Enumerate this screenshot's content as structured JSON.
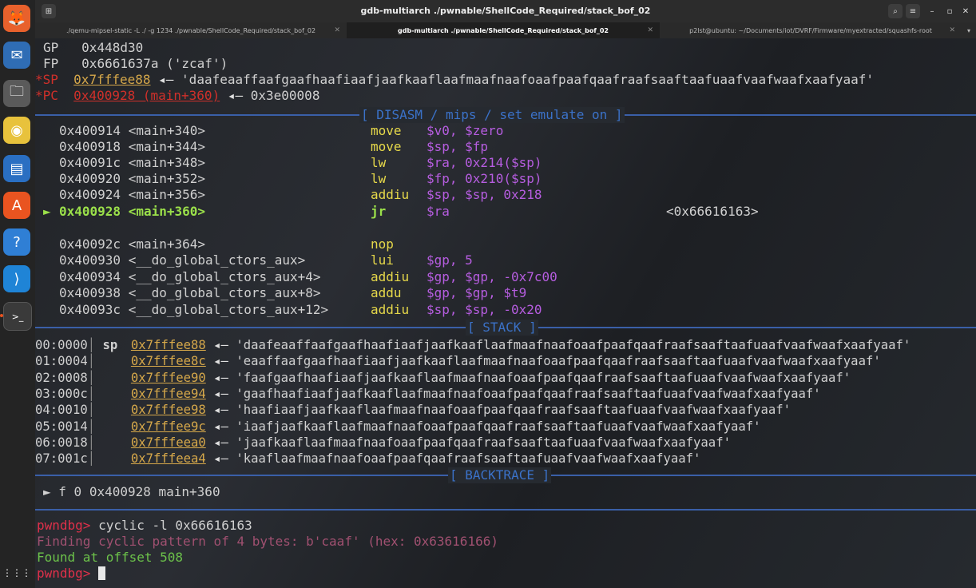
{
  "window": {
    "title": "gdb-multiarch ./pwnable/ShellCode_Required/stack_bof_02"
  },
  "tabs": [
    {
      "label": "./qemu-mipsel-static -L ./ -g 1234 ./pwnable/ShellCode_Required/stack_bof_02",
      "active": false
    },
    {
      "label": "gdb-multiarch ./pwnable/ShellCode_Required/stack_bof_02",
      "active": true
    },
    {
      "label": "p2lst@ubuntu: ~/Documents/iot/DVRF/Firmware/myextracted/squashfs-root",
      "active": false
    }
  ],
  "dock": [
    {
      "name": "firefox-icon",
      "glyph": "🦊"
    },
    {
      "name": "thunderbird-icon",
      "glyph": "✉"
    },
    {
      "name": "files-icon",
      "glyph": "🗀"
    },
    {
      "name": "rhythmbox-icon",
      "glyph": "◉"
    },
    {
      "name": "writer-icon",
      "glyph": "▤"
    },
    {
      "name": "software-icon",
      "glyph": "A"
    },
    {
      "name": "help-icon",
      "glyph": "?"
    },
    {
      "name": "vscode-icon",
      "glyph": "⟩"
    },
    {
      "name": "terminal-icon",
      "glyph": ">_"
    },
    {
      "name": "app-grid-icon",
      "glyph": "⋮⋮⋮"
    }
  ],
  "registers": {
    "gp": {
      "name": "GP",
      "value": "0x448d30"
    },
    "fp": {
      "name": "FP",
      "value": "0x6661637a ('zcaf')"
    },
    "sp": {
      "name": "*SP",
      "addr": "0x7fffee88",
      "arrow": "◂—",
      "value": "'daafeaaffaafgaafhaafiaafjaafkaaflaafmaafnaafoaafpaafqaafraafsaaftaafuaafvaafwaafxaafyaaf'"
    },
    "pc": {
      "name": "*PC",
      "addr": "0x400928 (main+360)",
      "arrow": "◂—",
      "value": "0x3e00008"
    }
  },
  "disasm": {
    "header": "[ DISASM / mips / set emulate on ]",
    "rows": [
      {
        "addr": "0x400914 <main+340>",
        "mn": "move",
        "ops": "$v0, $zero",
        "note": ""
      },
      {
        "addr": "0x400918 <main+344>",
        "mn": "move",
        "ops": "$sp, $fp",
        "note": ""
      },
      {
        "addr": "0x40091c <main+348>",
        "mn": "lw",
        "ops": "$ra, 0x214($sp)",
        "note": ""
      },
      {
        "addr": "0x400920 <main+352>",
        "mn": "lw",
        "ops": "$fp, 0x210($sp)",
        "note": ""
      },
      {
        "addr": "0x400924 <main+356>",
        "mn": "addiu",
        "ops": "$sp, $sp, 0x218",
        "note": ""
      },
      {
        "addr": "0x400928 <main+360>",
        "mn": "jr",
        "ops": "$ra",
        "note": "<0x66616163>",
        "current": true
      },
      {
        "addr": "0x40092c <main+364>",
        "mn": "nop",
        "ops": "",
        "note": ""
      },
      {
        "addr": "0x400930 <__do_global_ctors_aux>",
        "mn": "lui",
        "ops": "$gp, 5",
        "note": ""
      },
      {
        "addr": "0x400934 <__do_global_ctors_aux+4>",
        "mn": "addiu",
        "ops": "$gp, $gp, -0x7c00",
        "note": ""
      },
      {
        "addr": "0x400938 <__do_global_ctors_aux+8>",
        "mn": "addu",
        "ops": "$gp, $gp, $t9",
        "note": ""
      },
      {
        "addr": "0x40093c <__do_global_ctors_aux+12>",
        "mn": "addiu",
        "ops": "$sp, $sp, -0x20",
        "note": ""
      }
    ],
    "marker": "►"
  },
  "stack": {
    "header": "[ STACK ]",
    "rows": [
      {
        "idx": "00:0000",
        "reg": "sp",
        "addr": "0x7fffee88",
        "val": "'daafeaaffaafgaafhaafiaafjaafkaaflaafmaafnaafoaafpaafqaafraafsaaftaafuaafvaafwaafxaafyaaf'"
      },
      {
        "idx": "01:0004",
        "reg": "",
        "addr": "0x7fffee8c",
        "val": "'eaaffaafgaafhaafiaafjaafkaaflaafmaafnaafoaafpaafqaafraafsaaftaafuaafvaafwaafxaafyaaf'"
      },
      {
        "idx": "02:0008",
        "reg": "",
        "addr": "0x7fffee90",
        "val": "'faafgaafhaafiaafjaafkaaflaafmaafnaafoaafpaafqaafraafsaaftaafuaafvaafwaafxaafyaaf'"
      },
      {
        "idx": "03:000c",
        "reg": "",
        "addr": "0x7fffee94",
        "val": "'gaafhaafiaafjaafkaaflaafmaafnaafoaafpaafqaafraafsaaftaafuaafvaafwaafxaafyaaf'"
      },
      {
        "idx": "04:0010",
        "reg": "",
        "addr": "0x7fffee98",
        "val": "'haafiaafjaafkaaflaafmaafnaafoaafpaafqaafraafsaaftaafuaafvaafwaafxaafyaaf'"
      },
      {
        "idx": "05:0014",
        "reg": "",
        "addr": "0x7fffee9c",
        "val": "'iaafjaafkaaflaafmaafnaafoaafpaafqaafraafsaaftaafuaafvaafwaafxaafyaaf'"
      },
      {
        "idx": "06:0018",
        "reg": "",
        "addr": "0x7fffeea0",
        "val": "'jaafkaaflaafmaafnaafoaafpaafqaafraafsaaftaafuaafvaafwaafxaafyaaf'"
      },
      {
        "idx": "07:001c",
        "reg": "",
        "addr": "0x7fffeea4",
        "val": "'kaaflaafmaafnaafoaafpaafqaafraafsaaftaafuaafvaafwaafxaafyaaf'"
      }
    ],
    "arrow": "◂—"
  },
  "backtrace": {
    "header": "[ BACKTRACE ]",
    "line": "f 0 0x400928 main+360",
    "marker": "►"
  },
  "console": {
    "prompt": "pwndbg>",
    "command": "cyclic -l 0x66616163",
    "out1": "Finding cyclic pattern of 4 bytes: b'caaf' (hex: 0x63616166)",
    "out2": "Found at offset 508"
  },
  "colors": {
    "separator": "#3a5fa8",
    "address": "#d6a84a",
    "mnemonic": "#e6d84a",
    "operand": "#b65de0",
    "current": "#9be04a",
    "prompt": "#e0304a"
  }
}
